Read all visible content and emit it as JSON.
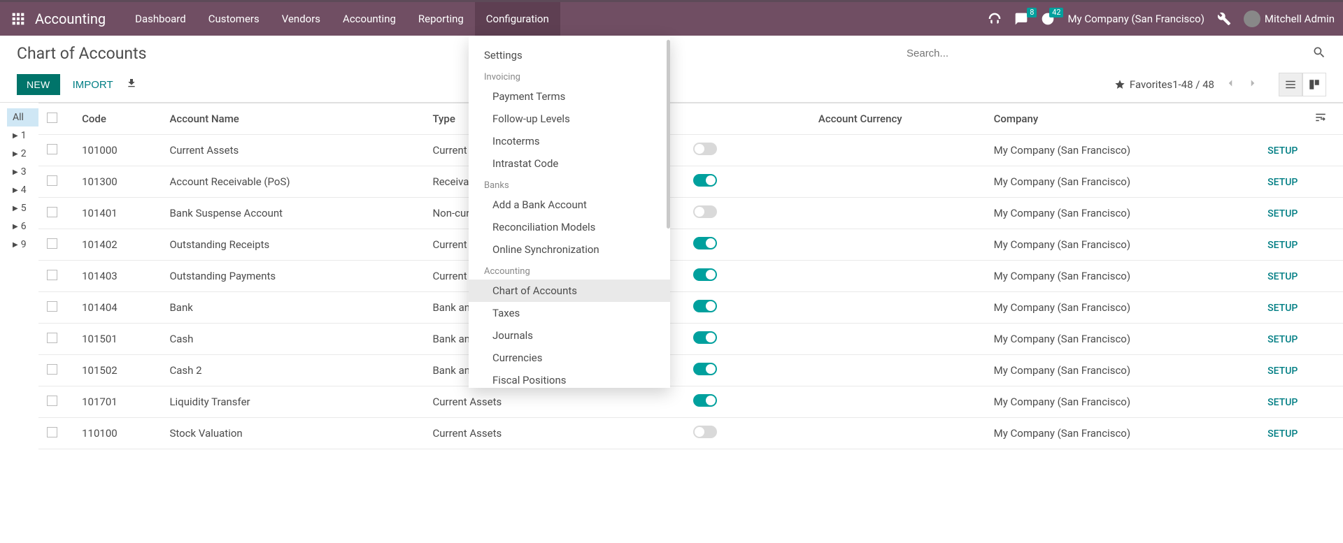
{
  "header": {
    "app_title": "Accounting",
    "nav": [
      "Dashboard",
      "Customers",
      "Vendors",
      "Accounting",
      "Reporting",
      "Configuration"
    ],
    "active_nav": "Configuration",
    "chat_badge": "8",
    "activity_badge": "42",
    "company": "My Company (San Francisco)",
    "user": "Mitchell Admin"
  },
  "control_panel": {
    "title": "Chart of Accounts",
    "new_label": "NEW",
    "import_label": "IMPORT",
    "favorites_label": "Favorites",
    "search_placeholder": "Search...",
    "pager_text": "1-48 / 48"
  },
  "sidebar": {
    "items": [
      "All",
      "1",
      "2",
      "3",
      "4",
      "5",
      "6",
      "9"
    ],
    "selected": "All"
  },
  "table": {
    "columns": {
      "code": "Code",
      "name": "Account Name",
      "type": "Type",
      "currency": "Account Currency",
      "company": "Company"
    },
    "setup_label": "SETUP",
    "rows": [
      {
        "code": "101000",
        "name": "Current Assets",
        "type": "Current Assets",
        "allow": false,
        "currency": "",
        "company": "My Company (San Francisco)"
      },
      {
        "code": "101300",
        "name": "Account Receivable (PoS)",
        "type": "Receivable",
        "allow": true,
        "currency": "",
        "company": "My Company (San Francisco)"
      },
      {
        "code": "101401",
        "name": "Bank Suspense Account",
        "type": "Non-current Assets",
        "allow": false,
        "currency": "",
        "company": "My Company (San Francisco)"
      },
      {
        "code": "101402",
        "name": "Outstanding Receipts",
        "type": "Current Assets",
        "allow": true,
        "currency": "",
        "company": "My Company (San Francisco)"
      },
      {
        "code": "101403",
        "name": "Outstanding Payments",
        "type": "Current Assets",
        "allow": true,
        "currency": "",
        "company": "My Company (San Francisco)"
      },
      {
        "code": "101404",
        "name": "Bank",
        "type": "Bank and Cash",
        "allow": true,
        "currency": "",
        "company": "My Company (San Francisco)"
      },
      {
        "code": "101501",
        "name": "Cash",
        "type": "Bank and Cash",
        "allow": true,
        "currency": "",
        "company": "My Company (San Francisco)"
      },
      {
        "code": "101502",
        "name": "Cash 2",
        "type": "Bank and Cash",
        "allow": true,
        "currency": "",
        "company": "My Company (San Francisco)"
      },
      {
        "code": "101701",
        "name": "Liquidity Transfer",
        "type": "Current Assets",
        "allow": true,
        "currency": "",
        "company": "My Company (San Francisco)"
      },
      {
        "code": "110100",
        "name": "Stock Valuation",
        "type": "Current Assets",
        "allow": false,
        "currency": "",
        "company": "My Company (San Francisco)"
      }
    ]
  },
  "dropdown": {
    "settings": "Settings",
    "sections": [
      {
        "header": "Invoicing",
        "items": [
          "Payment Terms",
          "Follow-up Levels",
          "Incoterms",
          "Intrastat Code"
        ]
      },
      {
        "header": "Banks",
        "items": [
          "Add a Bank Account",
          "Reconciliation Models",
          "Online Synchronization"
        ]
      },
      {
        "header": "Accounting",
        "items": [
          "Chart of Accounts",
          "Taxes",
          "Journals",
          "Currencies",
          "Fiscal Positions"
        ]
      }
    ],
    "selected": "Chart of Accounts"
  }
}
